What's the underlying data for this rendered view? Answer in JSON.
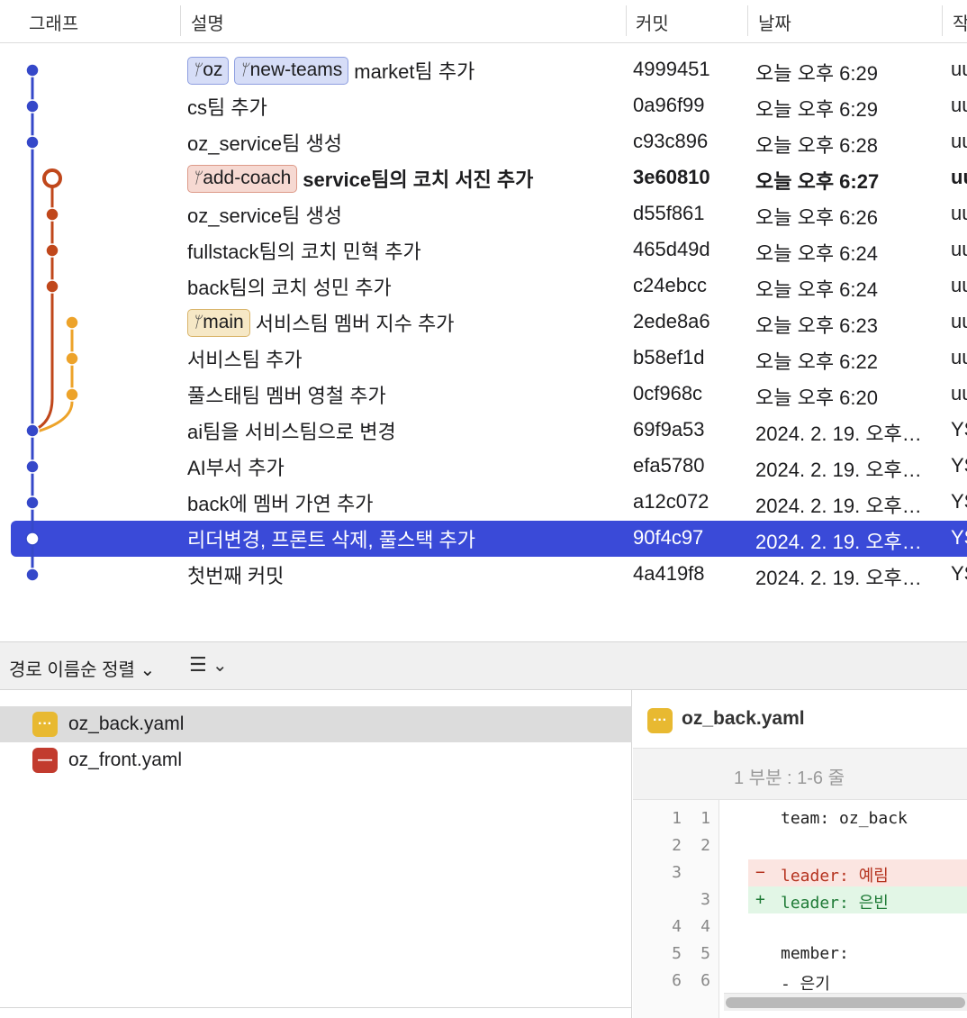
{
  "columns": {
    "graph": "그래프",
    "message": "설명",
    "commit": "커밋",
    "date": "날짜",
    "author": "작"
  },
  "colors": {
    "lane_main": "#3548c9",
    "lane_coach": "#c0471b",
    "lane_service": "#eda32a",
    "selected_row": "#3a4ad8"
  },
  "commits": [
    {
      "badges": [
        {
          "label": "oz",
          "color": "blue"
        },
        {
          "label": "new-teams",
          "color": "blue"
        }
      ],
      "message": "market팀 추가",
      "hash": "4999451",
      "date": "오늘 오후 6:29",
      "author": "uu"
    },
    {
      "badges": [],
      "message": "cs팀 추가",
      "hash": "0a96f99",
      "date": "오늘 오후 6:29",
      "author": "uu"
    },
    {
      "badges": [],
      "message": "oz_service팀 생성",
      "hash": "c93c896",
      "date": "오늘 오후 6:28",
      "author": "uu"
    },
    {
      "badges": [
        {
          "label": "add-coach",
          "color": "red"
        }
      ],
      "message": "service팀의 코치 서진 추가",
      "hash": "3e60810",
      "date": "오늘 오후 6:27",
      "author": "uu",
      "bold": true
    },
    {
      "badges": [],
      "message": "oz_service팀 생성",
      "hash": "d55f861",
      "date": "오늘 오후 6:26",
      "author": "uu"
    },
    {
      "badges": [],
      "message": "fullstack팀의 코치 민혁 추가",
      "hash": "465d49d",
      "date": "오늘 오후 6:24",
      "author": "uu"
    },
    {
      "badges": [],
      "message": "back팀의 코치 성민 추가",
      "hash": "c24ebcc",
      "date": "오늘 오후 6:24",
      "author": "uu"
    },
    {
      "badges": [
        {
          "label": "main",
          "color": "yellow"
        }
      ],
      "message": "서비스팀 멤버 지수 추가",
      "hash": "2ede8a6",
      "date": "오늘 오후 6:23",
      "author": "uu"
    },
    {
      "badges": [],
      "message": "서비스팀 추가",
      "hash": "b58ef1d",
      "date": "오늘 오후 6:22",
      "author": "uu"
    },
    {
      "badges": [],
      "message": "풀스태팀 멤버 영철 추가",
      "hash": "0cf968c",
      "date": "오늘 오후 6:20",
      "author": "uu"
    },
    {
      "badges": [],
      "message": "ai팀을 서비스팀으로 변경",
      "hash": "69f9a53",
      "date": "2024. 2. 19. 오후…",
      "author": "YS"
    },
    {
      "badges": [],
      "message": "AI부서 추가",
      "hash": "efa5780",
      "date": "2024. 2. 19. 오후…",
      "author": "YS"
    },
    {
      "badges": [],
      "message": "back에 멤버 가연 추가",
      "hash": "a12c072",
      "date": "2024. 2. 19. 오후…",
      "author": "YS"
    },
    {
      "badges": [],
      "message": "리더변경, 프론트 삭제, 풀스택 추가",
      "hash": "90f4c97",
      "date": "2024. 2. 19. 오후…",
      "author": "YS",
      "selected": true
    },
    {
      "badges": [],
      "message": "첫번째 커밋",
      "hash": "4a419f8",
      "date": "2024. 2. 19. 오후…",
      "author": "YS"
    }
  ],
  "toolbar": {
    "sort_label": "경로 이름순 정렬",
    "sort_chevron": "⌄",
    "list_icon": "☰",
    "list_chevron": "⌄"
  },
  "files": [
    {
      "name": "oz_back.yaml",
      "status": "modified",
      "icon": "···",
      "selected": true
    },
    {
      "name": "oz_front.yaml",
      "status": "deleted",
      "icon": "—"
    }
  ],
  "diff": {
    "file": "oz_back.yaml",
    "file_icon": "···",
    "hunk": "1 부분 : 1-6 줄",
    "lines": [
      {
        "old": "1",
        "new": "1",
        "type": "ctx",
        "sign": "",
        "text": "team: oz_back"
      },
      {
        "old": "2",
        "new": "2",
        "type": "ctx",
        "sign": "",
        "text": ""
      },
      {
        "old": "3",
        "new": "",
        "type": "del",
        "sign": "−",
        "text": "leader: 예림"
      },
      {
        "old": "",
        "new": "3",
        "type": "add",
        "sign": "+",
        "text": "leader: 은빈"
      },
      {
        "old": "4",
        "new": "4",
        "type": "ctx",
        "sign": "",
        "text": ""
      },
      {
        "old": "5",
        "new": "5",
        "type": "ctx",
        "sign": "",
        "text": "member:"
      },
      {
        "old": "6",
        "new": "6",
        "type": "ctx",
        "sign": "",
        "text": "- 은기"
      }
    ]
  }
}
